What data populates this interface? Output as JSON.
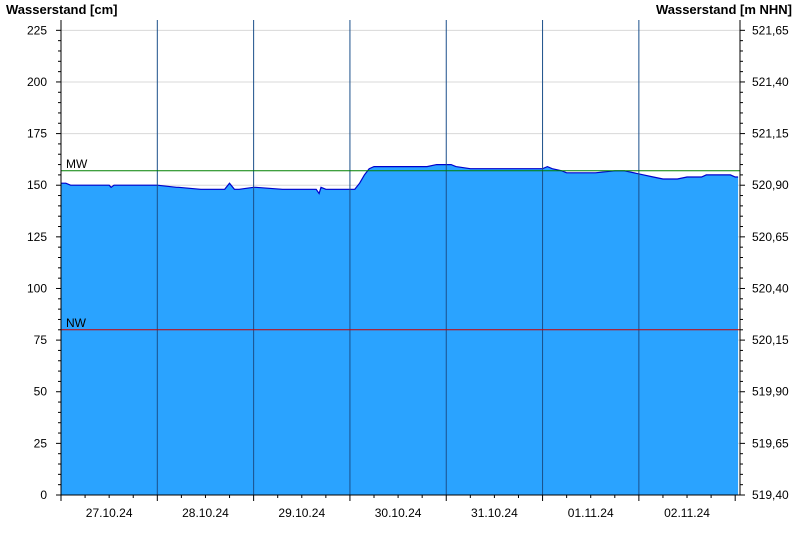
{
  "chart_data": {
    "type": "area",
    "y_left_label": "Wasserstand [cm]",
    "y_right_label": "Wasserstand [m NHN]",
    "ylim": [
      0,
      230
    ],
    "y_left_ticks": [
      0,
      25,
      50,
      75,
      100,
      125,
      150,
      175,
      200,
      225
    ],
    "y_right_ticks": [
      "519,40",
      "519,65",
      "519,90",
      "520,15",
      "520,40",
      "520,65",
      "520,90",
      "521,15",
      "521,40",
      "521,65"
    ],
    "x_tick_labels": [
      "27.10.24",
      "28.10.24",
      "29.10.24",
      "30.10.24",
      "31.10.24",
      "01.11.24",
      "02.11.24"
    ],
    "xlim_days": [
      0,
      7.05
    ],
    "grid": true,
    "reference_lines": [
      {
        "name": "MW",
        "value": 157,
        "color": "#008000"
      },
      {
        "name": "NW",
        "value": 80,
        "color": "#cc0000"
      }
    ],
    "fill_color": "#2aa3ff",
    "line_color": "#0000cc",
    "series": [
      {
        "x": [
          0,
          0.05,
          0.1,
          0.5,
          0.52,
          0.55,
          0.6,
          1.0,
          1.2,
          1.22,
          1.45,
          1.47,
          1.7,
          1.75,
          1.8,
          1.85,
          2.0,
          2.02,
          2.3,
          2.32,
          2.65,
          2.68,
          2.7,
          2.75,
          2.8,
          3.05,
          3.1,
          3.15,
          3.2,
          3.25,
          3.3,
          3.45,
          3.5,
          3.8,
          3.9,
          4.05,
          4.1,
          4.25,
          5.0,
          5.05,
          5.1,
          5.2,
          5.25,
          5.45,
          5.55,
          5.75,
          5.85,
          6.05,
          6.15,
          6.25,
          6.4,
          6.5,
          6.65,
          6.7,
          6.75,
          6.85,
          6.95,
          7.0,
          7.03
        ],
        "y": [
          151,
          151,
          150,
          150,
          149,
          150,
          150,
          150,
          149,
          149,
          148,
          148,
          148,
          151,
          148,
          148,
          149,
          149,
          148,
          148,
          148,
          146,
          149,
          148,
          148,
          148,
          151,
          155,
          158,
          159,
          159,
          159,
          159,
          159,
          160,
          160,
          159,
          158,
          158,
          159,
          158,
          157,
          156,
          156,
          156,
          157,
          157,
          155,
          154,
          153,
          153,
          154,
          154,
          155,
          155,
          155,
          155,
          154,
          154
        ]
      }
    ]
  }
}
